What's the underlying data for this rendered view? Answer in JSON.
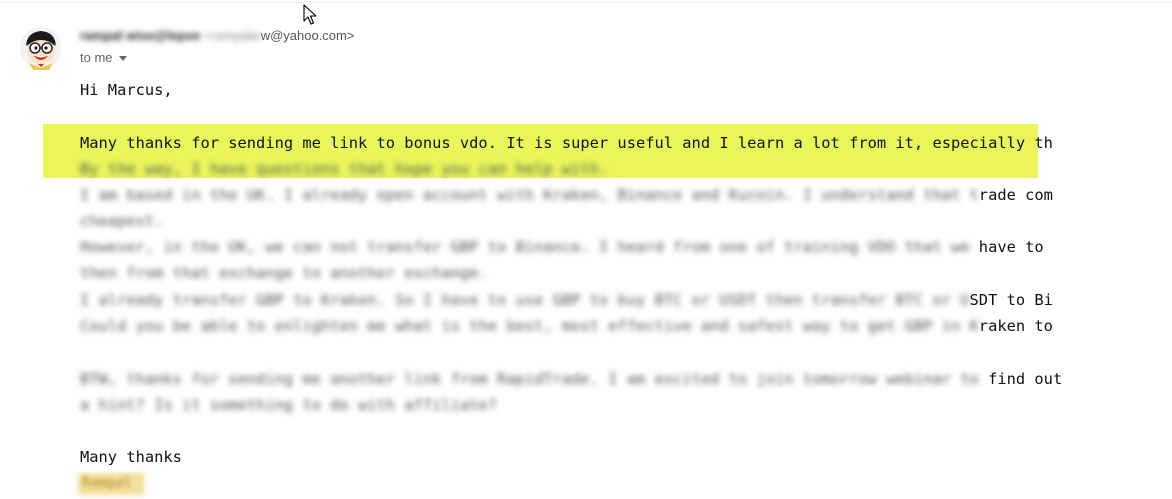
{
  "message": {
    "sender_name": "rampal wise@lepxe",
    "sender_email_blurred": " <rampalw",
    "sender_email_visible": "w@yahoo.com>",
    "recipient_label": "to me",
    "greeting": "Hi Marcus,",
    "paragraph1_line1": "Many thanks for sending me link to bonus vdo. It is super useful and I learn a lot from it, especially th",
    "paragraph1_line2": "By the way, I have questions that hope you can help with.",
    "paragraph2_line1_blur": "I am based in the UK. I already open account with Kraken, Binance and Kucoin. I understand that t",
    "paragraph2_line1_visible": "rade com",
    "paragraph2_line2": "cheapest.",
    "paragraph2_line3_blur": "However, in the UK, we can not transfer GBP to Binance. I heard from one of training VDO that we ",
    "paragraph2_line3_visible": "have to",
    "paragraph2_line4": "then from that exchange to another exchange.",
    "paragraph2_line5_blur": "I already transfer GBP to Kraken. So I have to use GBP to buy BTC or USDT then transfer BTC or U",
    "paragraph2_line5_visible": "SDT to Bi",
    "paragraph2_line6_blur": "Could you be able to enlighten me what is the best, most effective and safest way to get GBP in K",
    "paragraph2_line6_visible": "raken to",
    "paragraph3_line1_blur": "BTW, thanks for sending me another link from RapidTrade. I am excited to join tomorrow webinar to ",
    "paragraph3_line1_visible": "find out",
    "paragraph3_line2": "a hint? Is it something to do with affiliate?",
    "closing": "Many thanks",
    "signature": "Rampal"
  },
  "icons": {
    "avatar": "cartoon-boy-avatar",
    "caret": "chevron-down-icon",
    "cursor": "mouse-pointer-icon"
  },
  "colors": {
    "highlight": "#eaf55a",
    "signature_highlight": "#f4df9c"
  }
}
